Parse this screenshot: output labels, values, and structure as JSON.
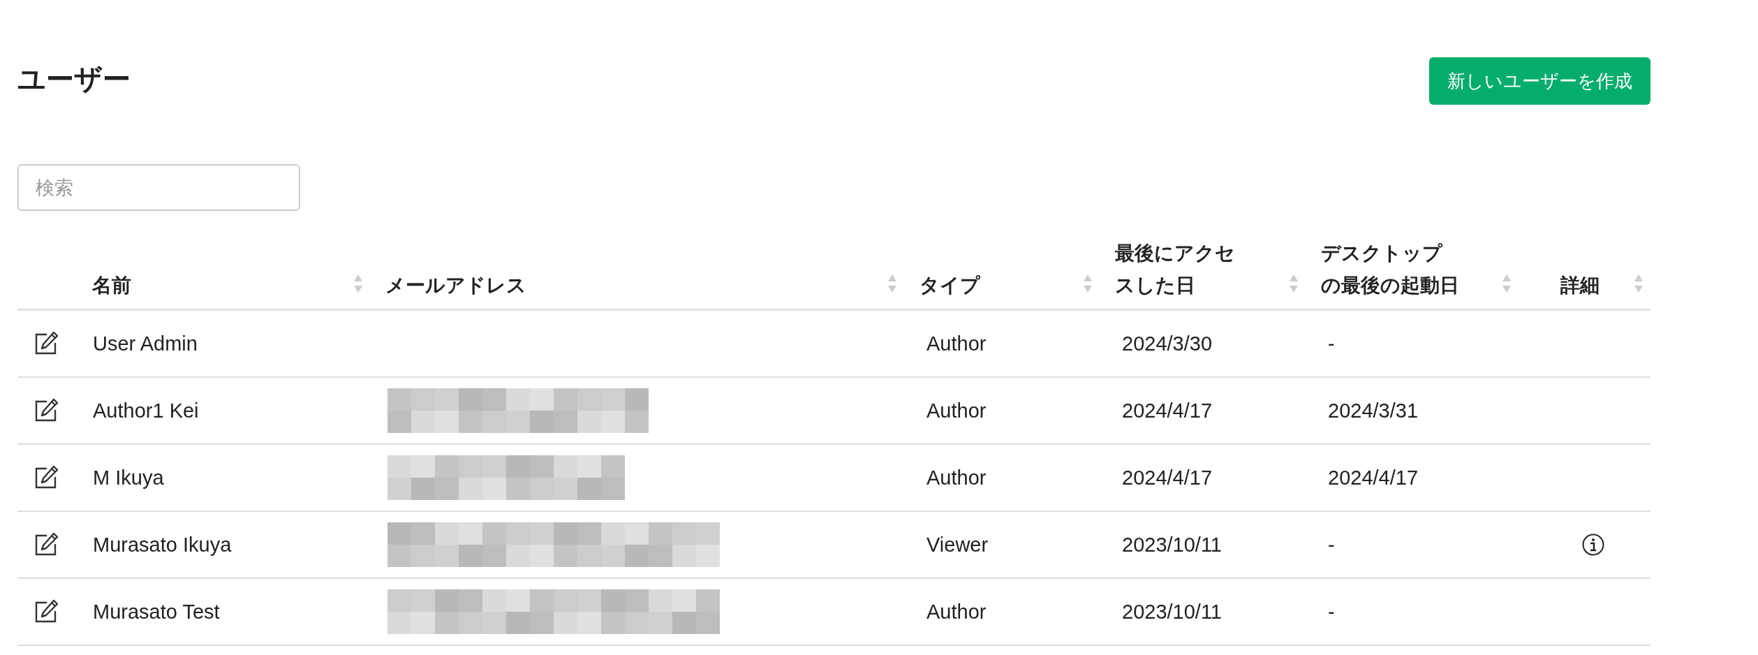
{
  "page": {
    "title": "ユーザー",
    "create_button": "新しいユーザーを作成"
  },
  "search": {
    "placeholder": "検索"
  },
  "table": {
    "columns": [
      {
        "label": "名前",
        "sortable": true
      },
      {
        "label": "メールアドレス",
        "sortable": true
      },
      {
        "label": "タイプ",
        "sortable": true
      },
      {
        "label": "最後にアクセスした日",
        "sortable": true
      },
      {
        "label": "デスクトップの最後の起動日",
        "sortable": true
      },
      {
        "label": "詳細",
        "sortable": true
      }
    ],
    "rows": [
      {
        "name": "User Admin",
        "email_redacted": false,
        "type": "Author",
        "last_access": "2024/3/30",
        "desktop_last_launch": "-",
        "info": false
      },
      {
        "name": "Author1 Kei",
        "email_redacted": true,
        "type": "Author",
        "last_access": "2024/4/17",
        "desktop_last_launch": "2024/3/31",
        "info": false
      },
      {
        "name": "M Ikuya",
        "email_redacted": true,
        "type": "Author",
        "last_access": "2024/4/17",
        "desktop_last_launch": "2024/4/17",
        "info": false
      },
      {
        "name": "Murasato Ikuya",
        "email_redacted": true,
        "type": "Viewer",
        "last_access": "2023/10/11",
        "desktop_last_launch": "-",
        "info": true
      },
      {
        "name": "Murasato Test",
        "email_redacted": true,
        "type": "Author",
        "last_access": "2023/10/11",
        "desktop_last_launch": "-",
        "info": false
      }
    ]
  }
}
